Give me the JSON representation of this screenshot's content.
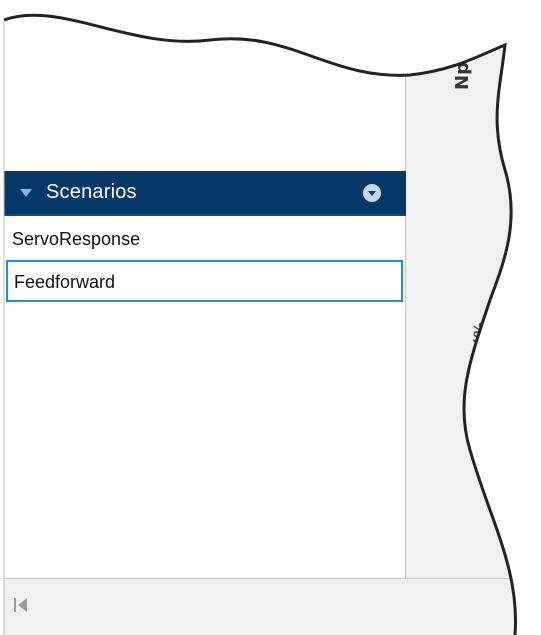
{
  "scenarios_panel": {
    "title": "Scenarios",
    "items": [
      {
        "label": "ServoResponse",
        "selected": false
      },
      {
        "label": "Feedforward",
        "selected": true
      }
    ]
  },
  "plot": {
    "y_axis_label": "Np (%)",
    "y_axis_label_partial": "(%"
  },
  "icons": {
    "collapse": "triangle-down-icon",
    "menu": "circle-chevron-down-icon",
    "nav_first": "go-to-first-icon"
  },
  "colors": {
    "header_bg": "#07386a",
    "header_text": "#ffffff",
    "selection_border": "#1e8fe0",
    "plot_bg": "#f0f0f0"
  }
}
